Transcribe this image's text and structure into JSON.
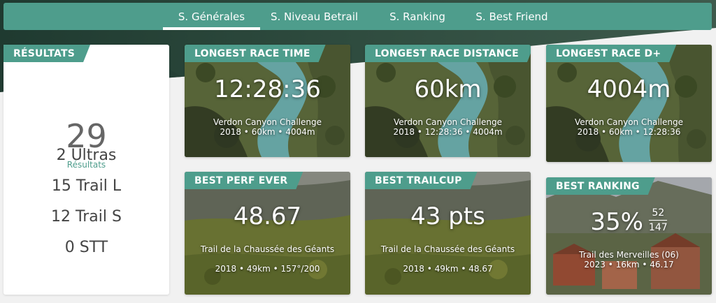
{
  "nav": {
    "tabs": [
      {
        "label": "S. Générales",
        "active": true
      },
      {
        "label": "S. Niveau Betrail",
        "active": false
      },
      {
        "label": "S. Ranking",
        "active": false
      },
      {
        "label": "S. Best Friend",
        "active": false
      }
    ]
  },
  "results": {
    "title": "RÉSULTATS",
    "count": "29",
    "count_label": "Résultats",
    "ultras": "2 Ultras",
    "trail_l": "15 Trail L",
    "trail_s": "12 Trail S",
    "stt": "0 STT"
  },
  "cards": {
    "longest_time": {
      "title": "LONGEST RACE TIME",
      "value": "12:28:36",
      "race": "Verdon Canyon Challenge",
      "meta": "2018 • 60km • 4004m"
    },
    "longest_distance": {
      "title": "LONGEST RACE DISTANCE",
      "value": "60km",
      "race": "Verdon Canyon Challenge",
      "meta": "2018 • 12:28:36 • 4004m"
    },
    "longest_dplus": {
      "title": "LONGEST RACE D+",
      "value": "4004m",
      "race": "Verdon Canyon Challenge",
      "meta": "2018 • 60km • 12:28:36"
    },
    "best_perf": {
      "title": "BEST PERF EVER",
      "value": "48.67",
      "race": "Trail de la Chaussée des Géants",
      "meta": "2018 • 49km • 157°/200"
    },
    "best_trailcup": {
      "title": "BEST TRAILCUP",
      "value": "43 pts",
      "race": "Trail de la Chaussée des Géants",
      "meta": "2018 • 49km • 48.67"
    },
    "best_ranking": {
      "title": "BEST RANKING",
      "value": "35%",
      "rank_num": "52",
      "rank_den": "147",
      "race": "Trail des Merveilles (06)",
      "meta": "2023 • 16km • 46.17"
    }
  },
  "colors": {
    "accent": "#4e9d8c",
    "card_bg": "#ffffff",
    "page_bg": "#f1f1f1"
  }
}
